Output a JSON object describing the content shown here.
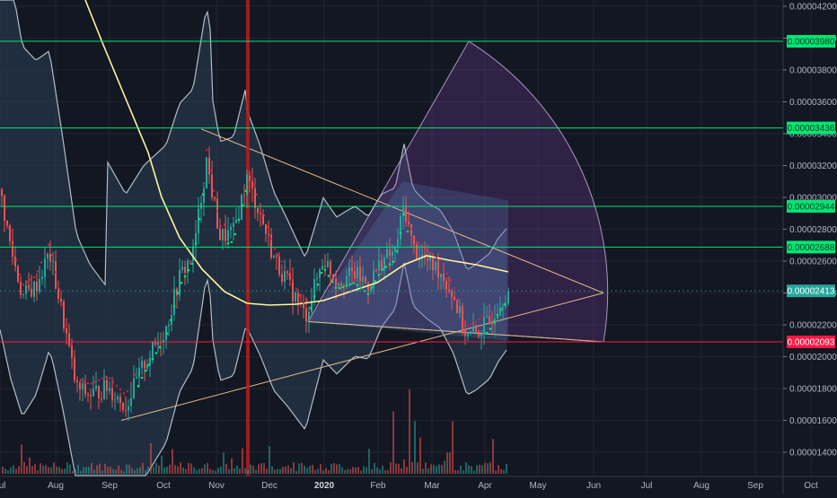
{
  "chart_data": {
    "type": "candlestick",
    "x_ticks": [
      "Jul",
      "Aug",
      "Sep",
      "Oct",
      "Nov",
      "Dec",
      "2020",
      "Feb",
      "Mar",
      "Apr",
      "May",
      "Jun",
      "Jul",
      "Aug",
      "Sep",
      "Oct"
    ],
    "y_ticks": [
      "0.00004200",
      "0.00004000",
      "0.00003800",
      "0.00003600",
      "0.00003400",
      "0.00003200",
      "0.00003000",
      "0.00002800",
      "0.00002600",
      "0.00002400",
      "0.00002200",
      "0.00002000",
      "0.00001800",
      "0.00001600",
      "0.00001400"
    ],
    "y_tick_values": [
      4.2e-05,
      4e-05,
      3.8e-05,
      3.6e-05,
      3.4e-05,
      3.2e-05,
      3e-05,
      2.8e-05,
      2.6e-05,
      2.4e-05,
      2.2e-05,
      2e-05,
      1.8e-05,
      1.6e-05,
      1.4e-05
    ],
    "ylim": [
      1.285e-05,
      4.21e-05
    ],
    "horizontal_levels": [
      {
        "label": "0.00003980",
        "value": 3.98e-05,
        "color": "#00e676"
      },
      {
        "label": "0.00003436",
        "value": 3.436e-05,
        "color": "#00e676"
      },
      {
        "label": "0.00002944",
        "value": 2.944e-05,
        "color": "#00e676"
      },
      {
        "label": "0.00002688",
        "value": 2.688e-05,
        "color": "#00e676"
      },
      {
        "label": "0.00002093",
        "value": 2.093e-05,
        "color": "#ff1744"
      }
    ],
    "last_price": {
      "label": "0.00002413",
      "value": 2.413e-05,
      "color": "#26a69a"
    },
    "vertical_marker": {
      "date": "mid-Nov",
      "color": "#b71c1c"
    },
    "series": [
      {
        "name": "price",
        "style": "candlestick",
        "up_color": "#26a69a",
        "down_color": "#ef5350"
      },
      {
        "name": "",
        "style": "line",
        "color": "#fff59d"
      },
      {
        "name": "",
        "style": "bands",
        "color": "#b0bec5",
        "fill": "#2a3f55"
      },
      {
        "name": "",
        "style": "dots",
        "color": "#00e676"
      },
      {
        "name": "",
        "style": "dots",
        "color": "#ff1744"
      }
    ],
    "drawings": [
      "triangle",
      "fib-fan-arc"
    ]
  }
}
